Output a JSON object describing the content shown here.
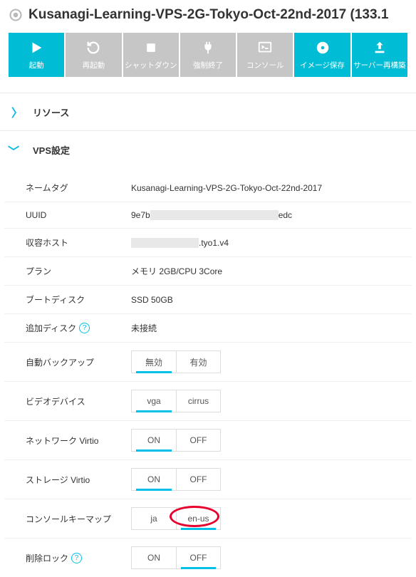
{
  "header": {
    "title": "Kusanagi-Learning-VPS-2G-Tokyo-Oct-22nd-2017 (133.1"
  },
  "toolbar": [
    {
      "label": "起動",
      "icon": "play",
      "state": "active"
    },
    {
      "label": "再起動",
      "icon": "reload",
      "state": "inactive"
    },
    {
      "label": "シャットダウン",
      "icon": "stop",
      "state": "inactive"
    },
    {
      "label": "強制終了",
      "icon": "plug",
      "state": "inactive"
    },
    {
      "label": "コンソール",
      "icon": "terminal",
      "state": "inactive"
    },
    {
      "label": "イメージ保存",
      "icon": "disk",
      "state": "alt"
    },
    {
      "label": "サーバー再構築",
      "icon": "upload",
      "state": "alt"
    }
  ],
  "sections": {
    "resources": {
      "title": "リソース",
      "expanded": false
    },
    "vps": {
      "title": "VPS設定",
      "expanded": true
    }
  },
  "settings": {
    "nametag": {
      "label": "ネームタグ",
      "value": "Kusanagi-Learning-VPS-2G-Tokyo-Oct-22nd-2017"
    },
    "uuid": {
      "label": "UUID",
      "prefix": "9e7b",
      "suffix": "edc"
    },
    "host": {
      "label": "収容ホスト",
      "suffix": ".tyo1.v4"
    },
    "plan": {
      "label": "プラン",
      "value": "メモリ 2GB/CPU 3Core"
    },
    "bootdisk": {
      "label": "ブートディスク",
      "value": "SSD 50GB"
    },
    "extradisk": {
      "label": "追加ディスク",
      "value": "未接続"
    },
    "backup": {
      "label": "自動バックアップ",
      "options": [
        "無効",
        "有効"
      ],
      "selected": 0
    },
    "video": {
      "label": "ビデオデバイス",
      "options": [
        "vga",
        "cirrus"
      ],
      "selected": 0
    },
    "netvirtio": {
      "label": "ネットワーク Virtio",
      "options": [
        "ON",
        "OFF"
      ],
      "selected": 0
    },
    "stovirtio": {
      "label": "ストレージ Virtio",
      "options": [
        "ON",
        "OFF"
      ],
      "selected": 0
    },
    "keymap": {
      "label": "コンソールキーマップ",
      "options": [
        "ja",
        "en-us"
      ],
      "selected": 1,
      "annotated": true
    },
    "dellock": {
      "label": "削除ロック",
      "options": [
        "ON",
        "OFF"
      ],
      "selected": 1
    }
  }
}
